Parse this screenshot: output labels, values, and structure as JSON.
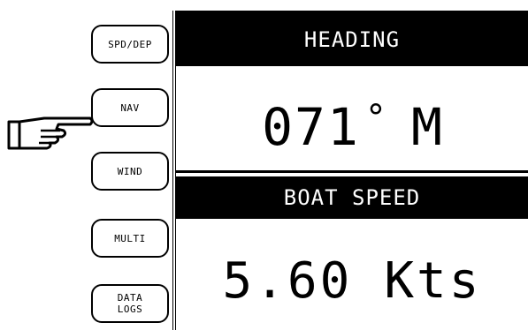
{
  "sidebar": {
    "buttons": [
      {
        "label": "SPD/DEP"
      },
      {
        "label": "NAV"
      },
      {
        "label": "WIND"
      },
      {
        "label": "MULTI"
      },
      {
        "label": "DATA\nLOGS"
      }
    ],
    "pointer_icon": "pointing-hand-icon"
  },
  "display": {
    "heading": {
      "title": "HEADING",
      "value": "071",
      "unit_symbol": "°",
      "unit": "M"
    },
    "boat_speed": {
      "title": "BOAT SPEED",
      "value": "5.60",
      "unit": "Kts"
    }
  },
  "colors": {
    "background": "#ffffff",
    "foreground": "#000000",
    "header_text": "#ffffff"
  }
}
